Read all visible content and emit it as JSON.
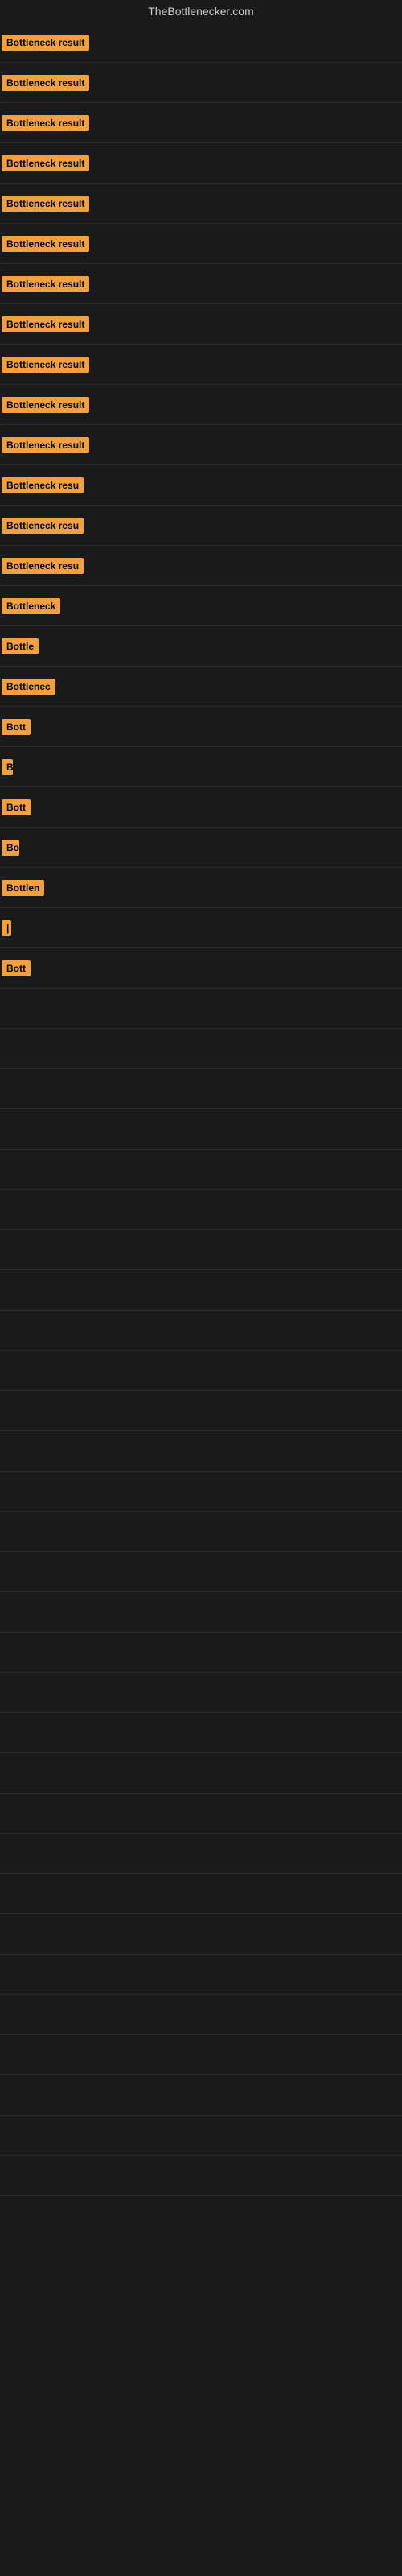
{
  "site": {
    "title": "TheBottlenecker.com"
  },
  "badges": [
    {
      "id": 1,
      "label": "Bottleneck result",
      "width": 120
    },
    {
      "id": 2,
      "label": "Bottleneck result",
      "width": 120
    },
    {
      "id": 3,
      "label": "Bottleneck result",
      "width": 120
    },
    {
      "id": 4,
      "label": "Bottleneck result",
      "width": 120
    },
    {
      "id": 5,
      "label": "Bottleneck result",
      "width": 120
    },
    {
      "id": 6,
      "label": "Bottleneck result",
      "width": 120
    },
    {
      "id": 7,
      "label": "Bottleneck result",
      "width": 120
    },
    {
      "id": 8,
      "label": "Bottleneck result",
      "width": 120
    },
    {
      "id": 9,
      "label": "Bottleneck result",
      "width": 120
    },
    {
      "id": 10,
      "label": "Bottleneck result",
      "width": 120
    },
    {
      "id": 11,
      "label": "Bottleneck result",
      "width": 120
    },
    {
      "id": 12,
      "label": "Bottleneck resu",
      "width": 110
    },
    {
      "id": 13,
      "label": "Bottleneck resu",
      "width": 110
    },
    {
      "id": 14,
      "label": "Bottleneck resu",
      "width": 110
    },
    {
      "id": 15,
      "label": "Bottleneck",
      "width": 80
    },
    {
      "id": 16,
      "label": "Bottle",
      "width": 50
    },
    {
      "id": 17,
      "label": "Bottlenec",
      "width": 68
    },
    {
      "id": 18,
      "label": "Bott",
      "width": 36
    },
    {
      "id": 19,
      "label": "B",
      "width": 14
    },
    {
      "id": 20,
      "label": "Bott",
      "width": 36
    },
    {
      "id": 21,
      "label": "Bo",
      "width": 22
    },
    {
      "id": 22,
      "label": "Bottlen",
      "width": 56
    },
    {
      "id": 23,
      "label": "|",
      "width": 8
    },
    {
      "id": 24,
      "label": "Bott",
      "width": 36
    }
  ]
}
